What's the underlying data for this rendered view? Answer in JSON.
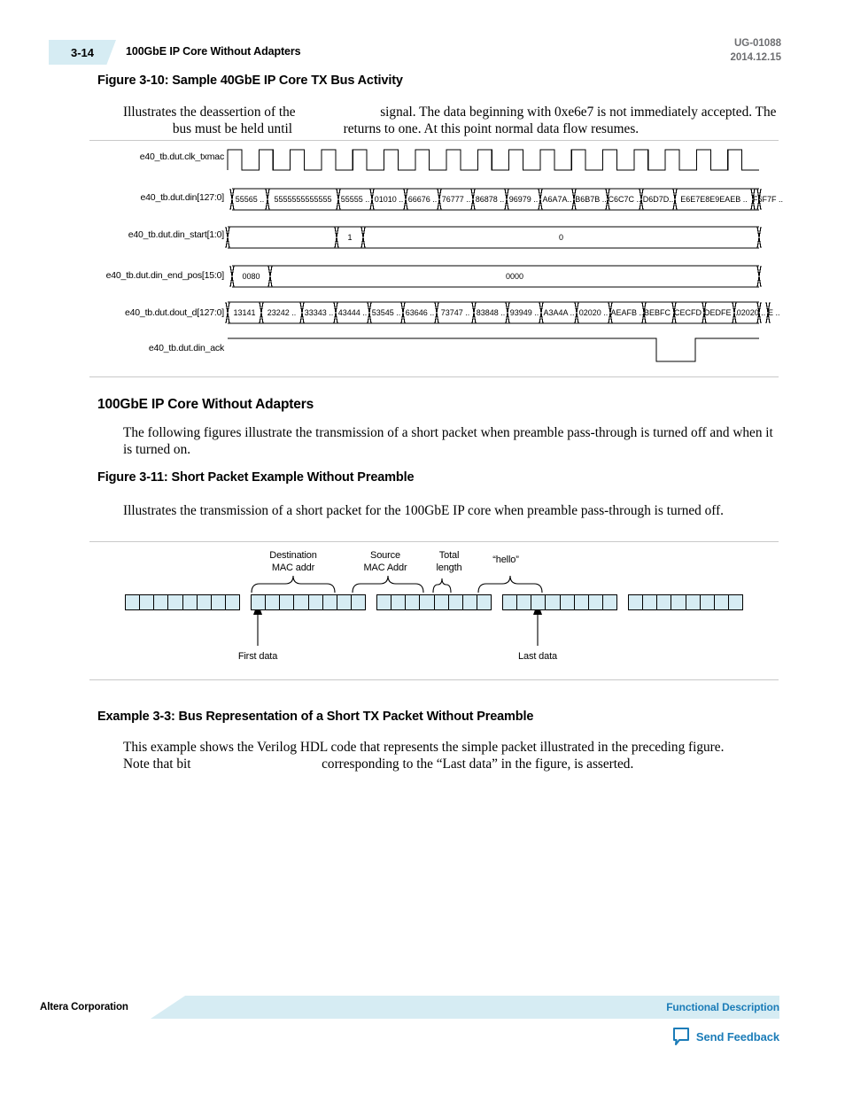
{
  "header": {
    "page_number": "3-14",
    "breadcrumb": "100GbE IP Core Without Adapters",
    "doc_id": "UG-01088",
    "doc_date": "2014.12.15"
  },
  "figure_3_10": {
    "title": "Figure 3-10: Sample 40GbE IP Core TX Bus Activity",
    "caption_part_1": "Illustrates the deassertion of the",
    "caption_part_2": "signal. The data beginning with 0xe6e7 is not immediately accepted. The",
    "caption_part_3": "bus must be held until",
    "caption_part_4": "returns to one. At this point normal data flow resumes.",
    "signals": [
      {
        "label": "e40_tb.dut.clk_txmac",
        "type": "clock"
      },
      {
        "label": "e40_tb.dut.din[127:0]",
        "type": "bus"
      },
      {
        "label": "e40_tb.dut.din_start[1:0]",
        "type": "bus"
      },
      {
        "label": "e40_tb.dut.din_end_pos[15:0]",
        "type": "bus"
      },
      {
        "label": "e40_tb.dut.dout_d[127:0]",
        "type": "bus"
      },
      {
        "label": "e40_tb.dut.din_ack",
        "type": "level"
      }
    ],
    "din_values": [
      "55565 ..",
      "5555555555555",
      "55555 ..",
      "01010 ..",
      "66676 ..",
      "76777 ..",
      "86878 ..",
      "96979 ..",
      "A6A7A..",
      "B6B7B ..",
      "C6C7C  ..",
      "D6D7D..",
      "E6E7E8E9EAEB   ..",
      "F6F7F  .."
    ],
    "din_start_values": [
      "1",
      "0"
    ],
    "din_end_pos_values": [
      "0080",
      "0000"
    ],
    "dout_d_values": [
      "13141",
      "23242 ..",
      "33343 ..",
      "43444 ..",
      "53545 ..",
      "63646 ..",
      "73747 ..",
      "83848 ..",
      "93949 ..",
      "A3A4A ..",
      "02020 ..",
      "AEAFB ..",
      "BEBFC ..",
      "CECFD ..",
      "DEDFE ..",
      "02020 ..",
      "E  .."
    ],
    "clock_cycles": 17
  },
  "section_100gbe": {
    "heading": "100GbE IP Core Without Adapters",
    "paragraph": "The following figures illustrate the transmission of a short packet when preamble pass-through is turned off and when it is turned on."
  },
  "figure_3_11": {
    "title": "Figure 3-11: Short Packet Example Without Preamble",
    "caption": "Illustrates the transmission of a short packet for the 100GbE IP core when preamble pass-through is turned off.",
    "field_labels": [
      {
        "line1": "Destination",
        "line2": "MAC addr"
      },
      {
        "line1": "Source",
        "line2": "MAC Addr"
      },
      {
        "line1": "Total",
        "line2": "length"
      },
      {
        "line1": "“hello”",
        "line2": ""
      }
    ],
    "annotations": [
      {
        "text": "First data"
      },
      {
        "text": "Last data"
      }
    ],
    "group_count": 5,
    "cells_per_group": 8,
    "cell_color": "#d6ecf3"
  },
  "example_3_3": {
    "title": "Example 3-3: Bus Representation of a Short TX Packet Without Preamble",
    "paragraph_part_1": "This example shows the Verilog HDL code that represents the simple packet illustrated in the preceding figure. Note that bit",
    "paragraph_part_2": "corresponding to the “Last data” in the figure, is asserted."
  },
  "footer": {
    "left": "Altera Corporation",
    "right": "Functional Description",
    "feedback": "Send Feedback",
    "accent_color": "#1b7cb8",
    "bar_color": "#d6ecf3"
  }
}
